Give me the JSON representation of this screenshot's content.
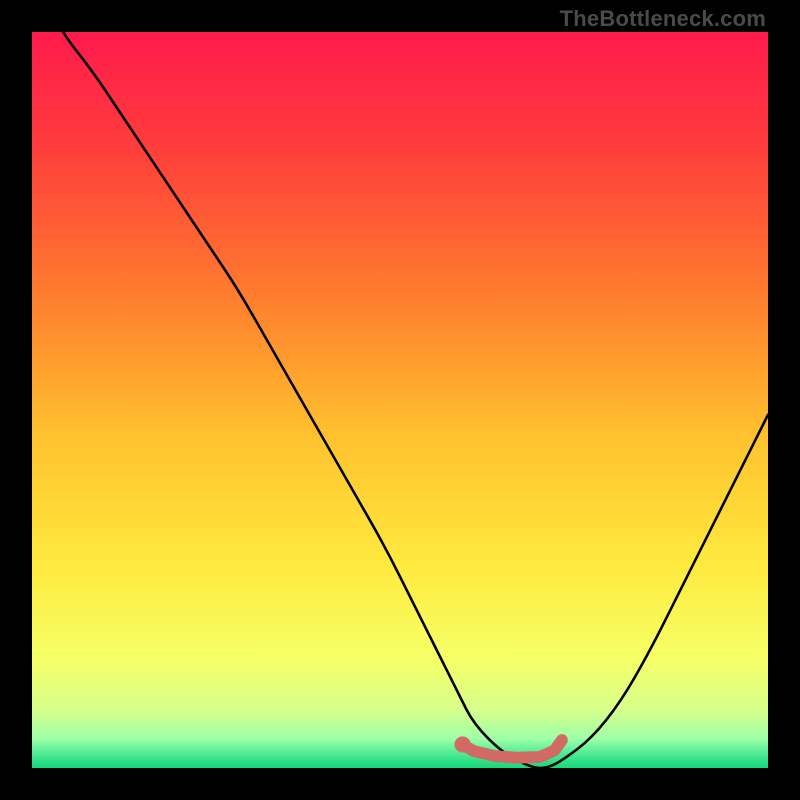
{
  "watermark": "TheBottleneck.com",
  "colors": {
    "frame": "#000000",
    "curve": "#000000",
    "accent_marker": "#d16a64",
    "gradient_stops": [
      {
        "offset": 0.0,
        "color": "#ff1a4d"
      },
      {
        "offset": 0.15,
        "color": "#ff3b3b"
      },
      {
        "offset": 0.35,
        "color": "#ff7a2e"
      },
      {
        "offset": 0.55,
        "color": "#ffc22e"
      },
      {
        "offset": 0.72,
        "color": "#ffe93d"
      },
      {
        "offset": 0.85,
        "color": "#f6ff66"
      },
      {
        "offset": 0.92,
        "color": "#d7ff8a"
      },
      {
        "offset": 0.96,
        "color": "#9effa8"
      },
      {
        "offset": 0.985,
        "color": "#3fe68f"
      },
      {
        "offset": 1.0,
        "color": "#15d97a"
      }
    ]
  },
  "chart_data": {
    "type": "line",
    "title": "",
    "xlabel": "",
    "ylabel": "",
    "xlim": [
      0,
      100
    ],
    "ylim": [
      0,
      100
    ],
    "series": [
      {
        "name": "bottleneck-curve",
        "x": [
          0,
          4,
          8,
          12,
          16,
          20,
          24,
          28,
          32,
          36,
          40,
          44,
          48,
          52,
          56,
          58,
          60,
          64,
          68,
          70,
          72,
          76,
          80,
          84,
          88,
          92,
          96,
          100
        ],
        "values": [
          108,
          100,
          95,
          89,
          83,
          77,
          71,
          65,
          58,
          51,
          44,
          37,
          30,
          22,
          14,
          10,
          6,
          2,
          0,
          0,
          1,
          4,
          9,
          16,
          24,
          32,
          40,
          48
        ]
      }
    ],
    "accent_segment": {
      "name": "optimal-range",
      "points": [
        {
          "x": 58.5,
          "y": 3.2
        },
        {
          "x": 60.0,
          "y": 2.3
        },
        {
          "x": 63.0,
          "y": 1.6
        },
        {
          "x": 66.0,
          "y": 1.4
        },
        {
          "x": 69.0,
          "y": 1.5
        },
        {
          "x": 71.0,
          "y": 2.4
        },
        {
          "x": 72.0,
          "y": 3.8
        }
      ],
      "start_dot": {
        "x": 58.5,
        "y": 3.2,
        "r": 1.1
      }
    }
  }
}
